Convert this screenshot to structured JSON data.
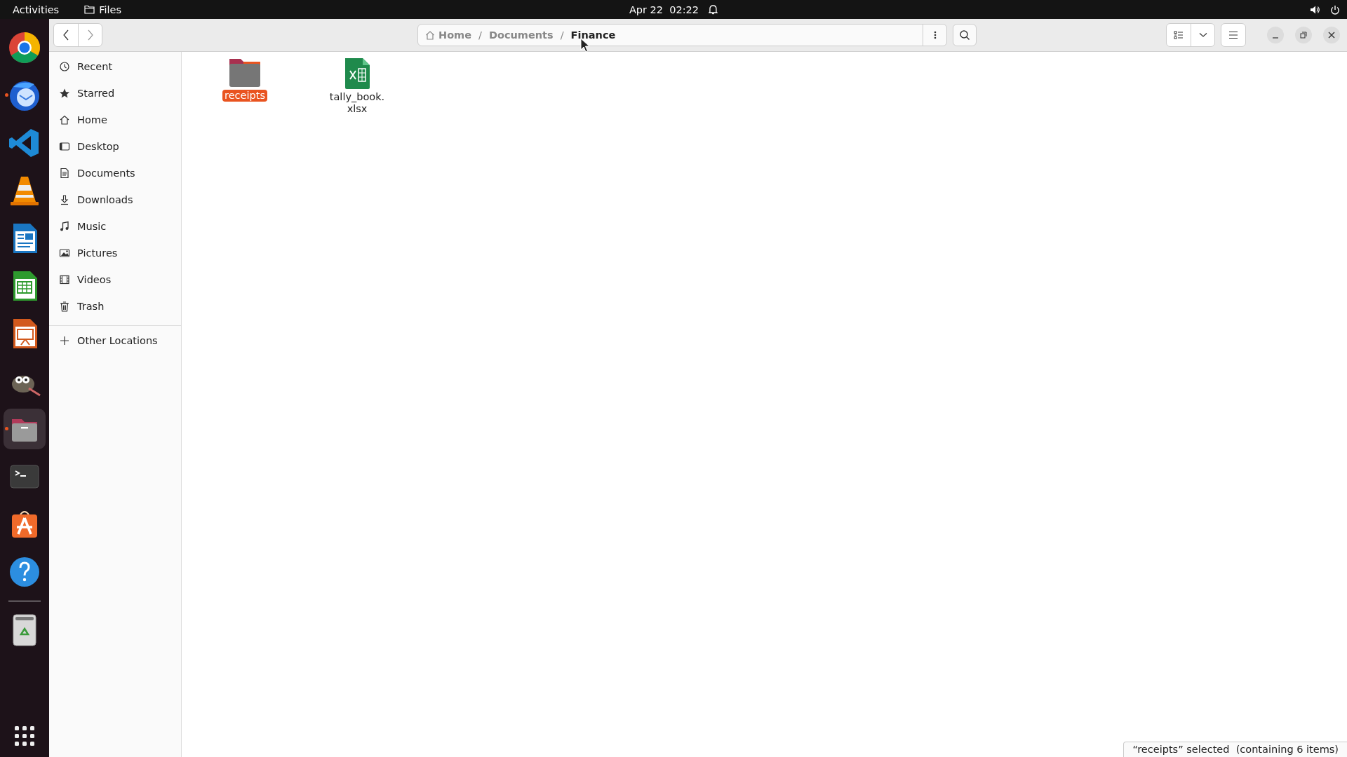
{
  "top_bar": {
    "activities": "Activities",
    "app_name": "Files",
    "clock": "Apr 22  02:22"
  },
  "dock": {
    "items": [
      {
        "running": false,
        "selected": false
      },
      {
        "running": true,
        "selected": false
      },
      {
        "running": false,
        "selected": false
      },
      {
        "running": false,
        "selected": false
      },
      {
        "running": false,
        "selected": false
      },
      {
        "running": false,
        "selected": false
      },
      {
        "running": false,
        "selected": false
      },
      {
        "running": false,
        "selected": false
      },
      {
        "running": true,
        "selected": true
      },
      {
        "running": false,
        "selected": false
      },
      {
        "running": false,
        "selected": false
      },
      {
        "running": false,
        "selected": false
      }
    ]
  },
  "path_bar": {
    "crumbs": [
      {
        "label": "Home",
        "selected": false
      },
      {
        "label": "Documents",
        "selected": false
      },
      {
        "label": "Finance",
        "selected": true
      }
    ],
    "separator": "/"
  },
  "sidebar": {
    "items": [
      {
        "label": "Recent",
        "selected": false
      },
      {
        "label": "Starred",
        "selected": false
      },
      {
        "label": "Home",
        "selected": false
      },
      {
        "label": "Desktop",
        "selected": false
      },
      {
        "label": "Documents",
        "selected": false
      },
      {
        "label": "Downloads",
        "selected": false
      },
      {
        "label": "Music",
        "selected": false
      },
      {
        "label": "Pictures",
        "selected": false
      },
      {
        "label": "Videos",
        "selected": false
      },
      {
        "label": "Trash",
        "selected": false
      }
    ],
    "other": {
      "label": "Other Locations"
    }
  },
  "files": [
    {
      "name": "receipts",
      "kind": "folder",
      "selected": true
    },
    {
      "name": "tally_book.xlsx",
      "kind": "spreadsheet",
      "selected": false
    }
  ],
  "status_bar": {
    "text": "“receipts” selected  (containing 6 items)"
  }
}
